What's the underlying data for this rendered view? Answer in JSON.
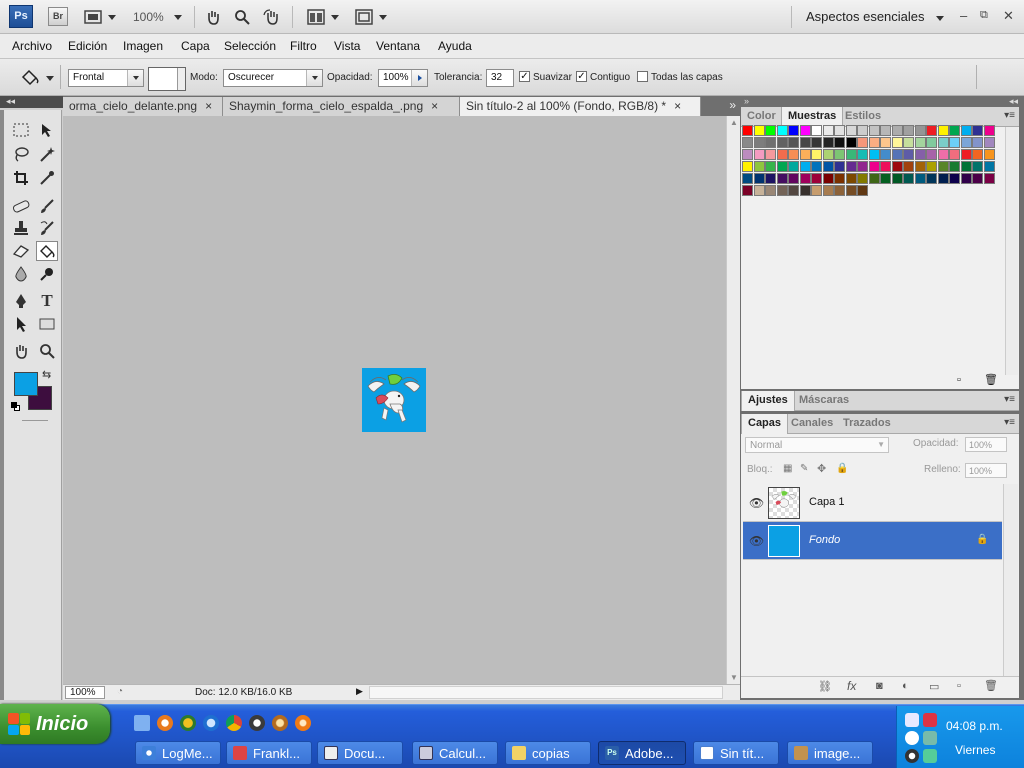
{
  "app": {
    "logo": "Ps",
    "bridge": "Br",
    "zoom": "100%",
    "workspace": "Aspectos esenciales",
    "win_min": "–",
    "win_restore": "⧉",
    "win_close": "✕"
  },
  "menu": [
    "Archivo",
    "Edición",
    "Imagen",
    "Capa",
    "Selección",
    "Filtro",
    "Vista",
    "Ventana",
    "Ayuda"
  ],
  "options": {
    "fill_source": "Frontal",
    "mode_label": "Modo:",
    "mode_value": "Oscurecer",
    "opacity_label": "Opacidad:",
    "opacity_value": "100%",
    "tolerance_label": "Tolerancia:",
    "tolerance_value": "32",
    "antialias_label": "Suavizar",
    "antialias_checked": true,
    "contiguous_label": "Contiguo",
    "contiguous_checked": true,
    "all_layers_label": "Todas las capas",
    "all_layers_checked": false
  },
  "tabs": [
    {
      "label": "orma_cielo_delante.png",
      "close": "×"
    },
    {
      "label": "Shaymin_forma_cielo_espalda_.png",
      "close": "×"
    },
    {
      "label": "Sin título-2 al 100% (Fondo, RGB/8) *",
      "close": "×",
      "active": true
    }
  ],
  "status": {
    "zoom": "100%",
    "doc_info": "Doc: 12.0 KB/16.0 KB"
  },
  "colors": {
    "foreground": "#0ba0e4",
    "background": "#3d0d3e",
    "image_bg": "#0ba0e4"
  },
  "panels": {
    "color_tab": "Color",
    "swatches_tab": "Muestras",
    "styles_tab": "Estilos",
    "adjustments_tab": "Ajustes",
    "masks_tab": "Máscaras",
    "layers_tab": "Capas",
    "channels_tab": "Canales",
    "paths_tab": "Trazados",
    "blend_mode": "Normal",
    "opacity_label": "Opacidad:",
    "opacity_value": "100%",
    "lock_label": "Bloq.:",
    "fill_label": "Relleno:",
    "fill_value": "100%"
  },
  "swatch_rows": [
    [
      "#ff0000",
      "#ffff00",
      "#00ff00",
      "#00ffff",
      "#0000ff",
      "#ff00ff",
      "#ffffff",
      "#ebebeb",
      "#e1e1e1",
      "#d7d7d7",
      "#cccccc",
      "#c2c2c2",
      "#b7b7b7",
      "#acacac",
      "#a0a0a0",
      "#959595",
      "#ee1d24",
      "#fff100",
      "#00a650",
      "#00aeef",
      "#2f3192",
      "#ed008c"
    ],
    [
      "#898989",
      "#7d7d7d",
      "#707070",
      "#626262",
      "#555555",
      "#464646",
      "#363636",
      "#262626",
      "#111111",
      "#000000",
      "#f7977a",
      "#fbad82",
      "#fdc68c",
      "#fff799",
      "#c6df9c",
      "#a4d49d",
      "#81ca9d",
      "#7bcdc9",
      "#6ccff7",
      "#7ca6d8",
      "#8293ca",
      "#a187be"
    ],
    [
      "#bc8cbf",
      "#f49bc1",
      "#f5999d",
      "#f16c4d",
      "#f68e54",
      "#fbaf5a",
      "#fff467",
      "#acd372",
      "#7dc473",
      "#39b778",
      "#16bcb4",
      "#00bff3",
      "#438ccb",
      "#5573b7",
      "#5e5ca7",
      "#855fa8",
      "#a763a9",
      "#ef6ea8",
      "#f16d7e",
      "#ee1d24",
      "#f16522",
      "#f7941d"
    ],
    [
      "#fff100",
      "#8fc63d",
      "#37b44a",
      "#00a650",
      "#00a99e",
      "#00aeef",
      "#0072bc",
      "#0054a5",
      "#2f3192",
      "#652c91",
      "#91278f",
      "#ed008c",
      "#ee105a",
      "#9d0a0f",
      "#a1410d",
      "#a36209",
      "#aba000",
      "#588528",
      "#197b30",
      "#007236",
      "#00736a",
      "#0076a4"
    ],
    [
      "#004a80",
      "#003370",
      "#1d1363",
      "#450e61",
      "#62055f",
      "#9e005c",
      "#9d0039",
      "#790000",
      "#7b3000",
      "#7c4900",
      "#827a00",
      "#3e6617",
      "#045f20",
      "#005824",
      "#005951",
      "#005b7e",
      "#003559",
      "#001e4f",
      "#0c004b",
      "#30004a",
      "#4b0048",
      "#7a0045"
    ],
    [
      "#7a0026",
      "#c7b299",
      "#998675",
      "#736357",
      "#534741",
      "#37302d",
      "#c69c6d",
      "#a77c50",
      "#8c6239",
      "#754c24",
      "#603813"
    ]
  ],
  "layers": [
    {
      "name": "Capa 1",
      "selected": false
    },
    {
      "name": "Fondo",
      "selected": true
    }
  ],
  "taskbar": {
    "start": "Inicio",
    "buttons": [
      "LogMe...",
      "Frankl...",
      "Docu...",
      "Calcul...",
      "copias",
      "Adobe...",
      "Sin tít...",
      "image..."
    ],
    "active_index": 5,
    "time": "04:08 p.m.",
    "day": "Viernes"
  }
}
